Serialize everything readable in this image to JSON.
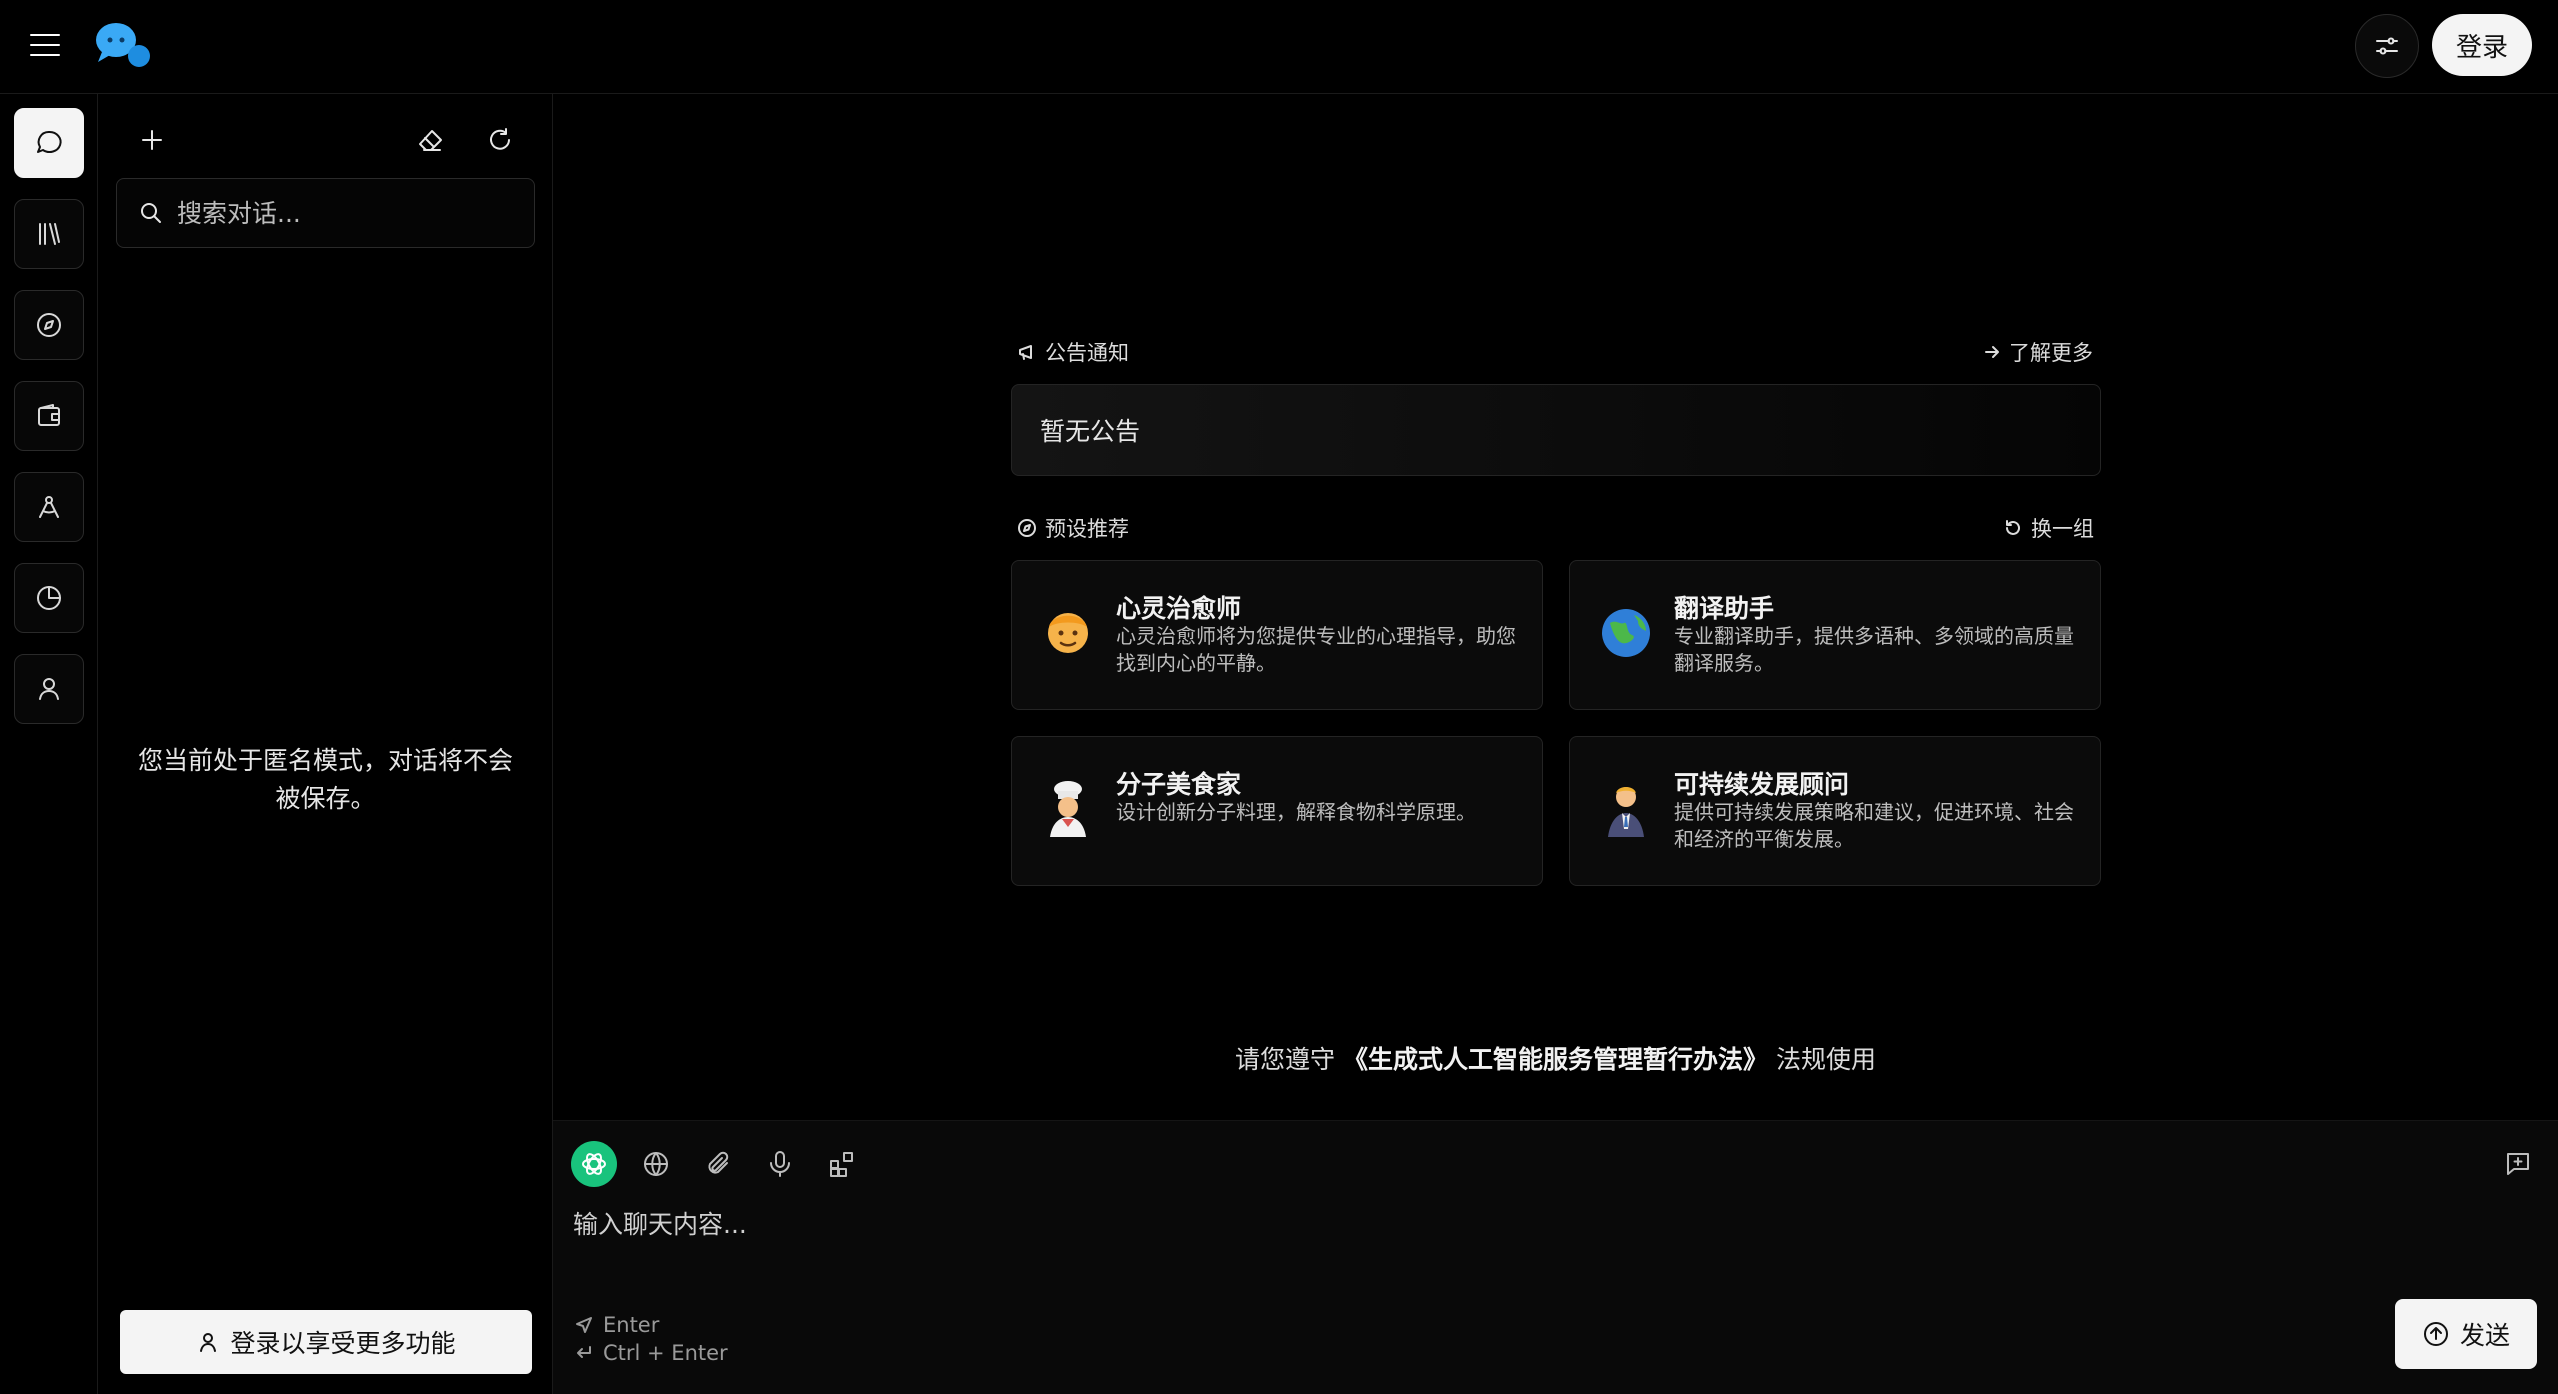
{
  "header": {
    "login_label": "登录"
  },
  "sidebar": {
    "search_placeholder": "搜索对话...",
    "anon_notice": "您当前处于匿名模式，对话将不会被保存。",
    "login_prompt": "登录以享受更多功能"
  },
  "announcement": {
    "heading": "公告通知",
    "more_label": "了解更多",
    "content": "暂无公告"
  },
  "presets": {
    "heading": "预设推荐",
    "refresh_label": "换一组",
    "cards": [
      {
        "title": "心灵治愈师",
        "desc": "心灵治愈师将为您提供专业的心理指导，助您找到内心的平静。",
        "icon": "person-emoji-icon"
      },
      {
        "title": "翻译助手",
        "desc": "专业翻译助手，提供多语种、多领域的高质量翻译服务。",
        "icon": "globe-emoji-icon"
      },
      {
        "title": "分子美食家",
        "desc": "设计创新分子料理，解释食物科学原理。",
        "icon": "chef-emoji-icon"
      },
      {
        "title": "可持续发展顾问",
        "desc": "提供可持续发展策略和建议，促进环境、社会和经济的平衡发展。",
        "icon": "business-person-emoji-icon"
      }
    ]
  },
  "rules": {
    "prefix": "请您遵守",
    "law": "《生成式人工智能服务管理暂行办法》",
    "suffix": "法规使用"
  },
  "composer": {
    "placeholder": "输入聊天内容...",
    "hint_send": "Enter",
    "hint_newline": "Ctrl + Enter",
    "send_label": "发送"
  },
  "colors": {
    "accent_green": "#19c37d",
    "background": "#000000",
    "button_light": "#f4f4f4"
  }
}
